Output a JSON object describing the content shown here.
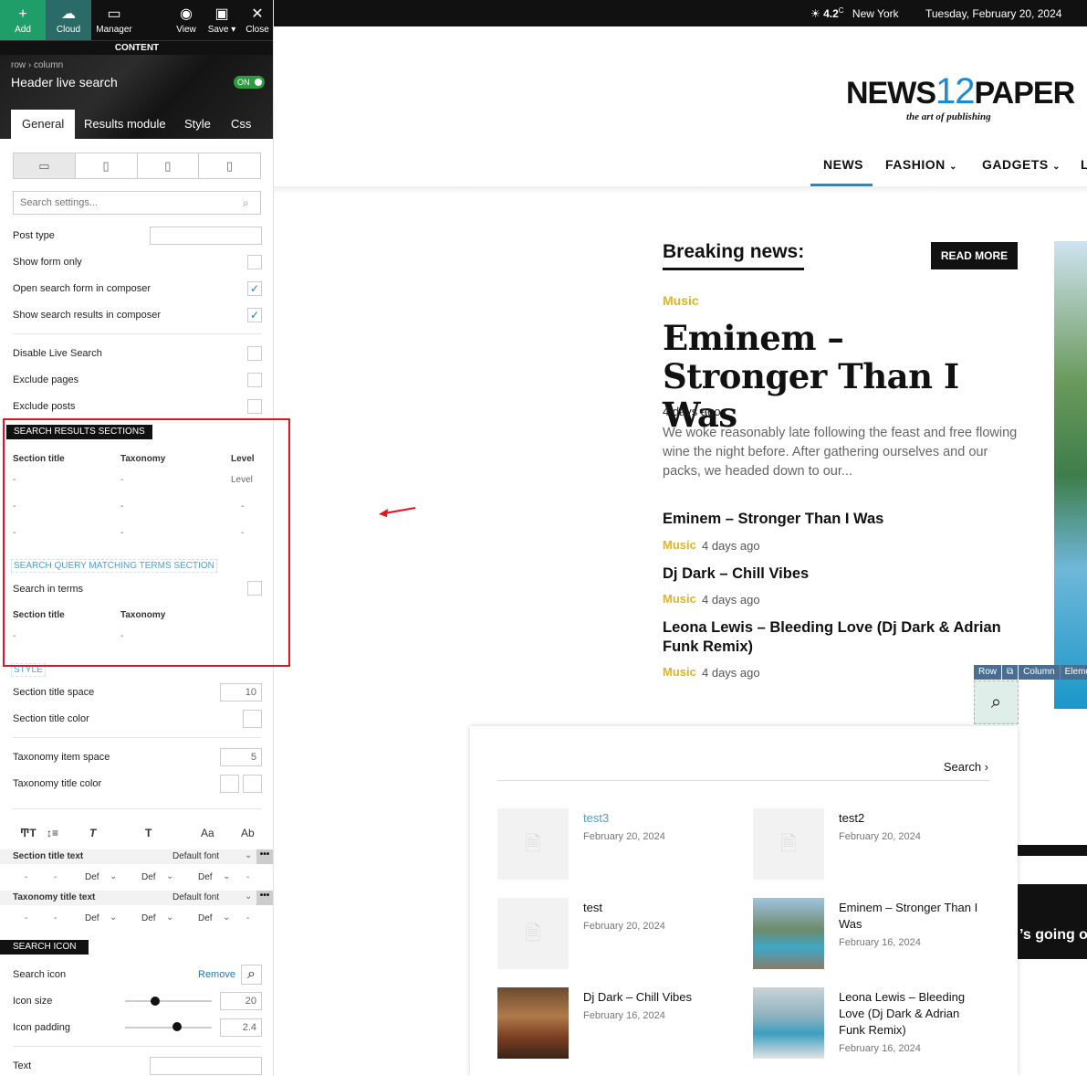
{
  "toolbar": {
    "add": "Add",
    "cloud": "Cloud",
    "manager": "Manager",
    "view": "View",
    "save": "Save ▾",
    "close": "Close",
    "content": "CONTENT"
  },
  "element": {
    "crumb": "row  ›  column",
    "title": "Header live search",
    "toggle": "ON"
  },
  "tabs": [
    "General",
    "Results module",
    "Style",
    "Css"
  ],
  "search_settings_placeholder": "Search settings...",
  "settings": {
    "post_type": "Post type",
    "show_form_only": "Show form only",
    "open_form": "Open search form in composer",
    "show_results": "Show search results in composer",
    "disable_live": "Disable Live Search",
    "exclude_pages": "Exclude pages",
    "exclude_posts": "Exclude posts"
  },
  "results_sections": {
    "header": "SEARCH RESULTS SECTIONS",
    "cols": [
      "Section title",
      "Taxonomy",
      "Level"
    ],
    "rows": [
      [
        "-",
        "-",
        "Level"
      ],
      [
        "-",
        "-",
        "-"
      ],
      [
        "-",
        "-",
        "-"
      ]
    ]
  },
  "query_section": {
    "header": "SEARCH QUERY MATCHING TERMS SECTION",
    "search_in_terms": "Search in terms",
    "cols": [
      "Section title",
      "Taxonomy"
    ],
    "rows": [
      [
        "-",
        "-"
      ]
    ]
  },
  "style": {
    "header": "STYLE",
    "section_title_space": "Section title space",
    "section_title_space_val": "10",
    "section_title_color": "Section title color",
    "tax_item_space": "Taxonomy item space",
    "tax_item_space_val": "5",
    "tax_title_color": "Taxonomy title color"
  },
  "typography": {
    "section_title_text": "Section title text",
    "tax_title_text": "Taxonomy title text",
    "font": "Default font",
    "def": "Def",
    "dash": "-",
    "more": "•••",
    "font_aa": "Aa"
  },
  "search_icon": {
    "header": "SEARCH ICON",
    "label": "Search icon",
    "remove": "Remove",
    "icon_size": "Icon size",
    "icon_size_val": "20",
    "icon_size_level": 0.35,
    "icon_padding": "Icon padding",
    "icon_padding_val": "2.4",
    "icon_padding_level": 0.6,
    "text": "Text"
  },
  "site": {
    "weather": "4.2",
    "weather_unit": "C",
    "city": "New York",
    "date": "Tuesday, February 20, 2024",
    "logo_news": "NEWS",
    "logo_12": "12",
    "logo_paper": "PAPER",
    "tagline": "the art of publishing",
    "nav": [
      "NEWS",
      "FASHION",
      "GADGETS",
      "L"
    ],
    "breaking": "Breaking news:",
    "read_more": "READ MORE",
    "main": {
      "category": "Music",
      "title": "Eminem – Stronger Than I Was",
      "ago": "4 days ago",
      "excerpt": "We woke reasonably late following the feast and free flowing wine the night before. After gathering ourselves and our packs, we headed down to our..."
    },
    "articles": [
      {
        "title": "Eminem – Stronger Than I Was",
        "cat": "Music",
        "ago": "4 days ago"
      },
      {
        "title": "Dj Dark – Chill Vibes",
        "cat": "Music",
        "ago": "4 days ago"
      },
      {
        "title": "Leona Lewis – Bleeding Love (Dj Dark & Adrian Funk Remix)",
        "cat": "Music",
        "ago": "4 days ago"
      }
    ],
    "rowbar": [
      "Row",
      "⧉",
      "Column",
      "Eleme"
    ],
    "search_link": "Search  ›",
    "results": [
      {
        "title": "test3",
        "date": "February 20, 2024"
      },
      {
        "title": "test2",
        "date": "February 20, 2024"
      },
      {
        "title": "test",
        "date": "February 20, 2024"
      },
      {
        "title": "Eminem – Stronger Than I Was",
        "date": "February 16, 2024"
      },
      {
        "title": "Dj Dark – Chill Vibes",
        "date": "February 16, 2024"
      },
      {
        "title": "Leona Lewis – Bleeding Love (Dj Dark & Adrian Funk Remix)",
        "date": "February 16, 2024"
      }
    ],
    "strip_text": "’s going o"
  },
  "colors": {
    "accent": "#1a8ad4",
    "music": "#e0b420",
    "toggle_on": "#2a9d3f",
    "highlight": "#e2141c",
    "add_button": "#1f9e6a"
  }
}
